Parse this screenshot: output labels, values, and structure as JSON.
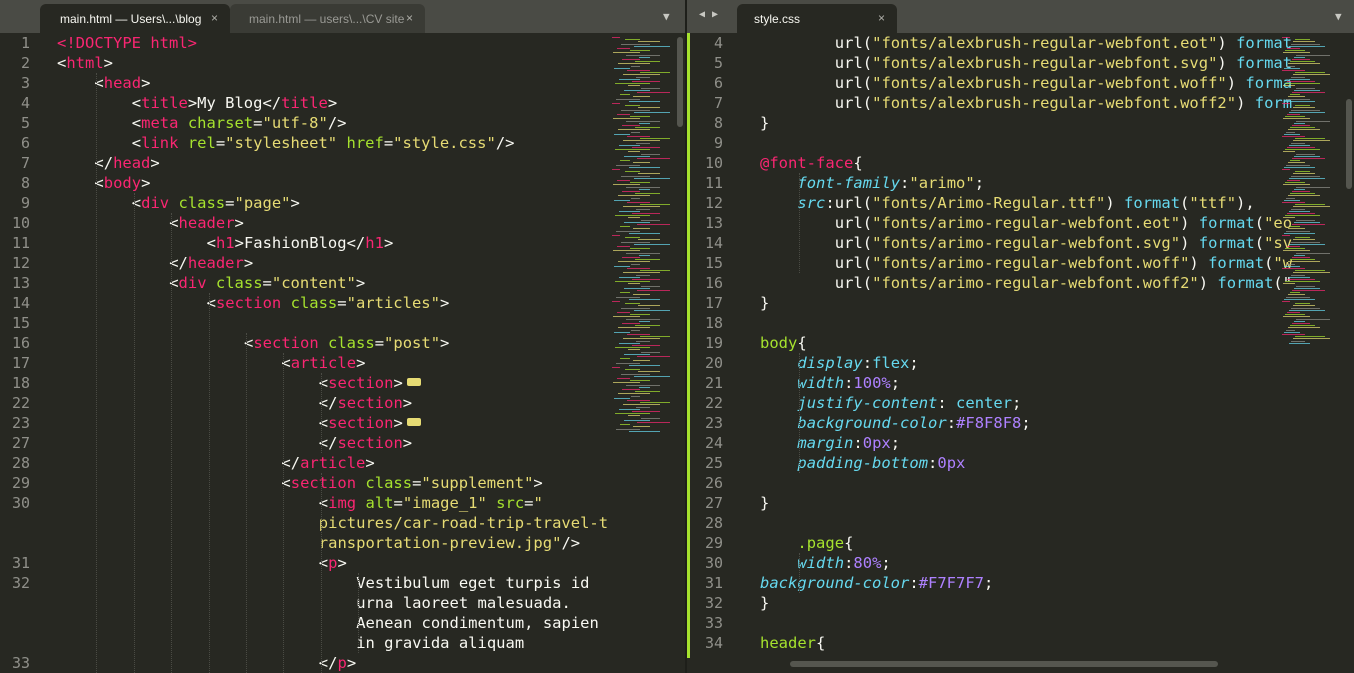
{
  "colors": {
    "bg": "#272822",
    "tag": "#f92672",
    "attr": "#a6e22e",
    "string": "#e6db74",
    "number": "#ae81ff",
    "property": "#66d9ef",
    "gutter": "#90908a"
  },
  "left_tabs": [
    {
      "label": "main.html — Users\\...\\blog",
      "active": true,
      "close": "×"
    },
    {
      "label": "main.html — users\\...\\CV site",
      "active": false,
      "close": "×"
    }
  ],
  "right_tabs": [
    {
      "label": "style.css",
      "active": true,
      "close": "×"
    }
  ],
  "icons": {
    "nav_left": "◀",
    "nav_right": "▶",
    "dropdown": "▼"
  },
  "left_lines": [
    {
      "num": "1",
      "tokens": [
        [
          "t",
          "<!DOCTYPE html>"
        ]
      ]
    },
    {
      "num": "2",
      "tokens": [
        [
          "",
          "<"
        ],
        [
          "t",
          "html"
        ],
        [
          "",
          ">"
        ]
      ]
    },
    {
      "num": "3",
      "tokens": [
        [
          "",
          "<"
        ],
        [
          "t",
          "head"
        ],
        [
          "",
          ">"
        ]
      ]
    },
    {
      "num": "4",
      "tokens": [
        [
          "",
          "<"
        ],
        [
          "t",
          "title"
        ],
        [
          "",
          ">My Blog</"
        ],
        [
          "t",
          "title"
        ],
        [
          "",
          ">"
        ]
      ]
    },
    {
      "num": "5",
      "tokens": [
        [
          "",
          "<"
        ],
        [
          "t",
          "meta"
        ],
        [
          "",
          " "
        ],
        [
          "a",
          "charset"
        ],
        [
          "",
          "="
        ],
        [
          "s",
          "\"utf-8\""
        ],
        [
          "",
          "/>"
        ]
      ]
    },
    {
      "num": "6",
      "tokens": [
        [
          "",
          "<"
        ],
        [
          "t",
          "link"
        ],
        [
          "",
          " "
        ],
        [
          "a",
          "rel"
        ],
        [
          "",
          "="
        ],
        [
          "s",
          "\"stylesheet\""
        ],
        [
          "",
          " "
        ],
        [
          "a",
          "href"
        ],
        [
          "",
          "="
        ],
        [
          "s",
          "\"style.css\""
        ],
        [
          "",
          "/>"
        ]
      ]
    },
    {
      "num": "7",
      "tokens": [
        [
          "",
          "</"
        ],
        [
          "t",
          "head"
        ],
        [
          "",
          ">"
        ]
      ]
    },
    {
      "num": "8",
      "tokens": [
        [
          "",
          "<"
        ],
        [
          "t",
          "body"
        ],
        [
          "",
          ">"
        ]
      ]
    },
    {
      "num": "9",
      "tokens": [
        [
          "",
          "<"
        ],
        [
          "t",
          "div"
        ],
        [
          "",
          " "
        ],
        [
          "a",
          "class"
        ],
        [
          "",
          "="
        ],
        [
          "s",
          "\"page\""
        ],
        [
          "",
          ">"
        ]
      ]
    },
    {
      "num": "10",
      "tokens": [
        [
          "",
          "<"
        ],
        [
          "t",
          "header"
        ],
        [
          "",
          ">"
        ]
      ]
    },
    {
      "num": "11",
      "tokens": [
        [
          "",
          "<"
        ],
        [
          "t",
          "h1"
        ],
        [
          "",
          ">FashionBlog</"
        ],
        [
          "t",
          "h1"
        ],
        [
          "",
          ">"
        ]
      ]
    },
    {
      "num": "12",
      "tokens": [
        [
          "",
          "</"
        ],
        [
          "t",
          "header"
        ],
        [
          "",
          ">"
        ]
      ]
    },
    {
      "num": "13",
      "tokens": [
        [
          "",
          "<"
        ],
        [
          "t",
          "div"
        ],
        [
          "",
          " "
        ],
        [
          "a",
          "class"
        ],
        [
          "",
          "="
        ],
        [
          "s",
          "\"content\""
        ],
        [
          "",
          ">"
        ]
      ]
    },
    {
      "num": "14",
      "tokens": [
        [
          "",
          "<"
        ],
        [
          "t",
          "section"
        ],
        [
          "",
          " "
        ],
        [
          "a",
          "class"
        ],
        [
          "",
          "="
        ],
        [
          "s",
          "\"articles\""
        ],
        [
          "",
          ">"
        ]
      ]
    },
    {
      "num": "15",
      "tokens": []
    },
    {
      "num": "16",
      "tokens": [
        [
          "",
          "<"
        ],
        [
          "t",
          "section"
        ],
        [
          "",
          " "
        ],
        [
          "a",
          "class"
        ],
        [
          "",
          "="
        ],
        [
          "s",
          "\"post\""
        ],
        [
          "",
          ">"
        ]
      ]
    },
    {
      "num": "17",
      "tokens": [
        [
          "",
          "<"
        ],
        [
          "t",
          "article"
        ],
        [
          "",
          ">"
        ]
      ]
    },
    {
      "num": "18",
      "tokens": [
        [
          "",
          "<"
        ],
        [
          "t",
          "section"
        ],
        [
          "",
          ">"
        ],
        [
          "fold",
          ""
        ]
      ]
    },
    {
      "num": "22",
      "tokens": [
        [
          "",
          "</"
        ],
        [
          "t",
          "section"
        ],
        [
          "",
          ">"
        ]
      ]
    },
    {
      "num": "23",
      "tokens": [
        [
          "",
          "<"
        ],
        [
          "t",
          "section"
        ],
        [
          "",
          ">"
        ],
        [
          "fold",
          ""
        ]
      ]
    },
    {
      "num": "27",
      "tokens": [
        [
          "",
          "</"
        ],
        [
          "t",
          "section"
        ],
        [
          "",
          ">"
        ]
      ]
    },
    {
      "num": "28",
      "tokens": [
        [
          "",
          "</"
        ],
        [
          "t",
          "article"
        ],
        [
          "",
          ">"
        ]
      ]
    },
    {
      "num": "29",
      "tokens": [
        [
          "",
          "<"
        ],
        [
          "t",
          "section"
        ],
        [
          "",
          " "
        ],
        [
          "a",
          "class"
        ],
        [
          "",
          "="
        ],
        [
          "s",
          "\"supplement\""
        ],
        [
          "",
          ">"
        ]
      ]
    },
    {
      "num": "30",
      "tokens": [
        [
          "",
          "<"
        ],
        [
          "t",
          "img"
        ],
        [
          "",
          " "
        ],
        [
          "a",
          "alt"
        ],
        [
          "",
          "="
        ],
        [
          "s",
          "\"image_1\""
        ],
        [
          "",
          " "
        ],
        [
          "a",
          "src"
        ],
        [
          "",
          "="
        ],
        [
          "s",
          "\""
        ]
      ]
    },
    {
      "num": "",
      "tokens": [
        [
          "s",
          "pictures/car-road-trip-travel-t"
        ]
      ]
    },
    {
      "num": "",
      "tokens": [
        [
          "s",
          "ransportation-preview.jpg\""
        ],
        [
          "",
          "/>"
        ]
      ]
    },
    {
      "num": "31",
      "tokens": [
        [
          "",
          "<"
        ],
        [
          "t",
          "p"
        ],
        [
          "",
          ">"
        ]
      ]
    },
    {
      "num": "32",
      "tokens": [
        [
          "",
          "Vestibulum eget turpis id"
        ]
      ]
    },
    {
      "num": "",
      "tokens": [
        [
          "",
          "urna laoreet malesuada."
        ]
      ]
    },
    {
      "num": "",
      "tokens": [
        [
          "",
          "Aenean condimentum, sapien"
        ]
      ]
    },
    {
      "num": "",
      "tokens": [
        [
          "",
          "in gravida aliquam"
        ]
      ]
    },
    {
      "num": "33",
      "tokens": [
        [
          "",
          "</"
        ],
        [
          "t",
          "p"
        ],
        [
          "",
          ">"
        ]
      ]
    }
  ],
  "right_lines": [
    {
      "num": "4",
      "tokens": [
        [
          "",
          "url("
        ],
        [
          "s",
          "\"fonts/alexbrush-regular-webfont.eot\""
        ],
        [
          "",
          ") "
        ],
        [
          "f",
          "format"
        ]
      ]
    },
    {
      "num": "5",
      "tokens": [
        [
          "",
          "url("
        ],
        [
          "s",
          "\"fonts/alexbrush-regular-webfont.svg\""
        ],
        [
          "",
          ") "
        ],
        [
          "f",
          "format"
        ]
      ]
    },
    {
      "num": "6",
      "tokens": [
        [
          "",
          "url("
        ],
        [
          "s",
          "\"fonts/alexbrush-regular-webfont.woff\""
        ],
        [
          "",
          ") "
        ],
        [
          "f",
          "forma"
        ]
      ]
    },
    {
      "num": "7",
      "tokens": [
        [
          "",
          "url("
        ],
        [
          "s",
          "\"fonts/alexbrush-regular-webfont.woff2\""
        ],
        [
          "",
          ") "
        ],
        [
          "f",
          "form"
        ]
      ]
    },
    {
      "num": "8",
      "tokens": [
        [
          "",
          "}"
        ]
      ]
    },
    {
      "num": "9",
      "tokens": []
    },
    {
      "num": "10",
      "tokens": [
        [
          "at",
          "@font-face"
        ],
        [
          "",
          "{"
        ]
      ]
    },
    {
      "num": "11",
      "tokens": [
        [
          "p",
          "font-family"
        ],
        [
          "",
          ":"
        ],
        [
          "s",
          "\"arimo\""
        ],
        [
          "",
          ";"
        ]
      ]
    },
    {
      "num": "12",
      "tokens": [
        [
          "p",
          "src"
        ],
        [
          "",
          ":url("
        ],
        [
          "s",
          "\"fonts/Arimo-Regular.ttf\""
        ],
        [
          "",
          ") "
        ],
        [
          "f",
          "format"
        ],
        [
          "",
          "("
        ],
        [
          "s",
          "\"ttf\""
        ],
        [
          "",
          "),"
        ]
      ]
    },
    {
      "num": "13",
      "tokens": [
        [
          "",
          "url("
        ],
        [
          "s",
          "\"fonts/arimo-regular-webfont.eot\""
        ],
        [
          "",
          ") "
        ],
        [
          "f",
          "format"
        ],
        [
          "",
          "("
        ],
        [
          "s",
          "\"eo"
        ]
      ]
    },
    {
      "num": "14",
      "tokens": [
        [
          "",
          "url("
        ],
        [
          "s",
          "\"fonts/arimo-regular-webfont.svg\""
        ],
        [
          "",
          ") "
        ],
        [
          "f",
          "format"
        ],
        [
          "",
          "("
        ],
        [
          "s",
          "\"sv"
        ]
      ]
    },
    {
      "num": "15",
      "tokens": [
        [
          "",
          "url("
        ],
        [
          "s",
          "\"fonts/arimo-regular-webfont.woff\""
        ],
        [
          "",
          ") "
        ],
        [
          "f",
          "format"
        ],
        [
          "",
          "("
        ],
        [
          "s",
          "\"w"
        ]
      ]
    },
    {
      "num": "16",
      "tokens": [
        [
          "",
          "url("
        ],
        [
          "s",
          "\"fonts/arimo-regular-webfont.woff2\""
        ],
        [
          "",
          ") "
        ],
        [
          "f",
          "format"
        ],
        [
          "",
          "(\""
        ]
      ]
    },
    {
      "num": "17",
      "tokens": [
        [
          "",
          "}"
        ]
      ]
    },
    {
      "num": "18",
      "tokens": []
    },
    {
      "num": "19",
      "tokens": [
        [
          "sel",
          "body"
        ],
        [
          "",
          "{"
        ]
      ]
    },
    {
      "num": "20",
      "tokens": [
        [
          "p",
          "display"
        ],
        [
          "",
          ":"
        ],
        [
          "v",
          "flex"
        ],
        [
          "",
          ";"
        ]
      ]
    },
    {
      "num": "21",
      "tokens": [
        [
          "p",
          "width"
        ],
        [
          "",
          ":"
        ],
        [
          "n",
          "100%"
        ],
        [
          "",
          ";"
        ]
      ]
    },
    {
      "num": "22",
      "tokens": [
        [
          "p",
          "justify-content"
        ],
        [
          "",
          ": "
        ],
        [
          "v",
          "center"
        ],
        [
          "",
          ";"
        ]
      ]
    },
    {
      "num": "23",
      "tokens": [
        [
          "p",
          "background-color"
        ],
        [
          "",
          ":"
        ],
        [
          "n",
          "#F8F8F8"
        ],
        [
          "",
          ";"
        ]
      ]
    },
    {
      "num": "24",
      "tokens": [
        [
          "p",
          "margin"
        ],
        [
          "",
          ":"
        ],
        [
          "n",
          "0px"
        ],
        [
          "",
          ";"
        ]
      ]
    },
    {
      "num": "25",
      "tokens": [
        [
          "p",
          "padding-bottom"
        ],
        [
          "",
          ":"
        ],
        [
          "n",
          "0px"
        ]
      ]
    },
    {
      "num": "26",
      "tokens": []
    },
    {
      "num": "27",
      "tokens": [
        [
          "",
          "}"
        ]
      ]
    },
    {
      "num": "28",
      "tokens": []
    },
    {
      "num": "29",
      "tokens": [
        [
          "sel",
          ".page"
        ],
        [
          "",
          "{"
        ]
      ]
    },
    {
      "num": "30",
      "tokens": [
        [
          "p",
          "width"
        ],
        [
          "",
          ":"
        ],
        [
          "n",
          "80%"
        ],
        [
          "",
          ";"
        ]
      ]
    },
    {
      "num": "31",
      "tokens": [
        [
          "p",
          "background-color"
        ],
        [
          "",
          ":"
        ],
        [
          "n",
          "#F7F7F7"
        ],
        [
          "",
          ";"
        ]
      ]
    },
    {
      "num": "32",
      "tokens": [
        [
          "",
          "}"
        ]
      ]
    },
    {
      "num": "33",
      "tokens": []
    },
    {
      "num": "34",
      "tokens": [
        [
          "sel",
          "header"
        ],
        [
          "",
          "{"
        ]
      ]
    }
  ]
}
